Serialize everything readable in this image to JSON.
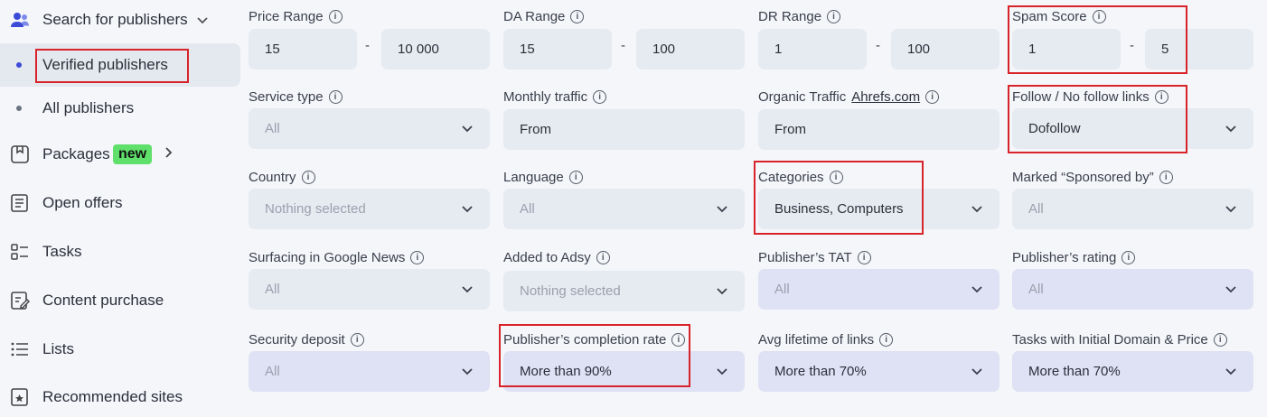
{
  "sidebar": {
    "search_title": "Search for publishers",
    "verified": "Verified publishers",
    "all": "All publishers",
    "packages": "Packages",
    "packages_badge": "new",
    "open_offers": "Open offers",
    "tasks": "Tasks",
    "content_purchase": "Content purchase",
    "lists": "Lists",
    "recommended": "Recommended sites"
  },
  "filters": {
    "price_range": {
      "label": "Price Range",
      "from": "15",
      "to": "10 000"
    },
    "da_range": {
      "label": "DA Range",
      "from": "15",
      "to": "100"
    },
    "dr_range": {
      "label": "DR Range",
      "from": "1",
      "to": "100"
    },
    "spam_score": {
      "label": "Spam Score",
      "from": "1",
      "to": "5"
    },
    "service_type": {
      "label": "Service type",
      "value": "All"
    },
    "monthly_traffic": {
      "label": "Monthly traffic",
      "value": "From"
    },
    "organic_traffic": {
      "label": "Organic Traffic",
      "link": "Ahrefs.com",
      "value": "From"
    },
    "follow_links": {
      "label": "Follow / No follow links",
      "value": "Dofollow"
    },
    "country": {
      "label": "Country",
      "value": "Nothing selected"
    },
    "language": {
      "label": "Language",
      "value": "All"
    },
    "categories": {
      "label": "Categories",
      "value": "Business, Computers"
    },
    "sponsored": {
      "label": "Marked “Sponsored by”",
      "value": "All"
    },
    "google_news": {
      "label": "Surfacing in Google News",
      "value": "All"
    },
    "added_adsy": {
      "label": "Added to Adsy",
      "value": "Nothing selected"
    },
    "publisher_tat": {
      "label": "Publisher’s TAT",
      "value": "All"
    },
    "publisher_rating": {
      "label": "Publisher’s rating",
      "value": "All"
    },
    "security_deposit": {
      "label": "Security deposit",
      "value": "All"
    },
    "completion_rate": {
      "label": "Publisher’s completion rate",
      "value": "More than 90%"
    },
    "avg_lifetime": {
      "label": "Avg lifetime of links",
      "value": "More than 70%"
    },
    "initial_domain": {
      "label": "Tasks with Initial Domain & Price",
      "value": "More than 70%"
    }
  },
  "colors": {
    "accent": "#3b4bd8",
    "highlight": "#d8232a",
    "badge": "#5fe06a"
  }
}
